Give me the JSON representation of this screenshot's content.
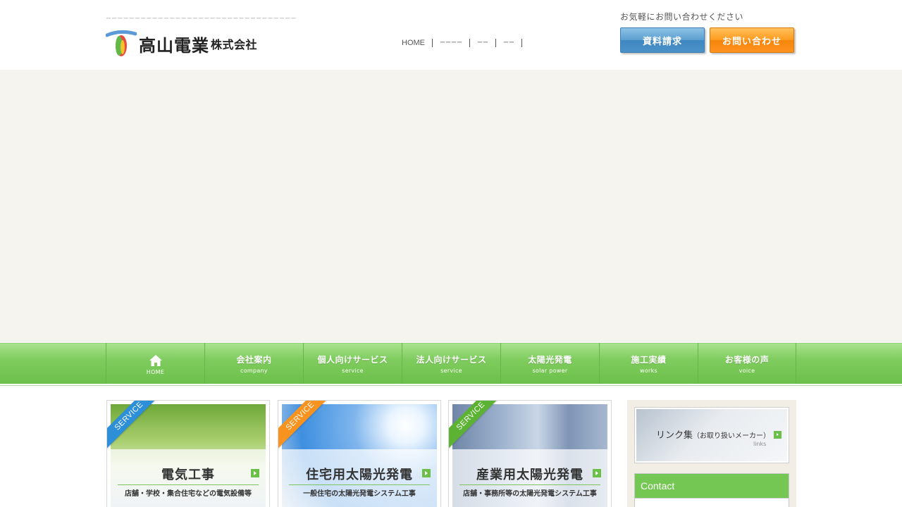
{
  "header": {
    "tagline": "ーーーーーーーーーーーーーーーーーーーーーーーーーーーーーーーーー",
    "company_name": "高山電業",
    "company_suffix": "株式会社",
    "contact_note": "お気軽にお問い合わせください",
    "request_docs_label": "資料請求",
    "inquiry_label": "お問い合わせ"
  },
  "topnav": [
    {
      "label": "HOME"
    },
    {
      "label": "ーーーー"
    },
    {
      "label": "ーー"
    },
    {
      "label": "ーー"
    }
  ],
  "global_nav": [
    {
      "label": "",
      "sub": "HOME"
    },
    {
      "label": "会社案内",
      "sub": "company"
    },
    {
      "label": "個人向けサービス",
      "sub": "service"
    },
    {
      "label": "法人向けサービス",
      "sub": "service"
    },
    {
      "label": "太陽光発電",
      "sub": "solar power"
    },
    {
      "label": "施工実績",
      "sub": "works"
    },
    {
      "label": "お客様の声",
      "sub": "voice"
    }
  ],
  "cards": [
    {
      "ribbon": "SERVICE",
      "title": "電気工事",
      "subtitle": "店舗・学校・集合住宅などの電気設備等"
    },
    {
      "ribbon": "SERVICE",
      "title": "住宅用太陽光発電",
      "subtitle": "一般住宅の太陽光発電システム工事"
    },
    {
      "ribbon": "SERVICE",
      "title": "産業用太陽光発電",
      "subtitle": "店舗・事務所等の太陽光発電システム工事"
    }
  ],
  "sidebar": {
    "links_label": "リンク集",
    "links_paren": "（お取り扱いメーカー）",
    "links_en": "links",
    "contact_heading": "Contact"
  },
  "colors": {
    "nav_green": "#7fcc5e",
    "doc_button_blue": "#4b92c8",
    "inquiry_button_orange": "#ff9420",
    "ribbon_blue": "#2d8fd8",
    "ribbon_orange": "#f7931e",
    "ribbon_green": "#5bb233",
    "hero_bg": "#f6f4ef"
  }
}
